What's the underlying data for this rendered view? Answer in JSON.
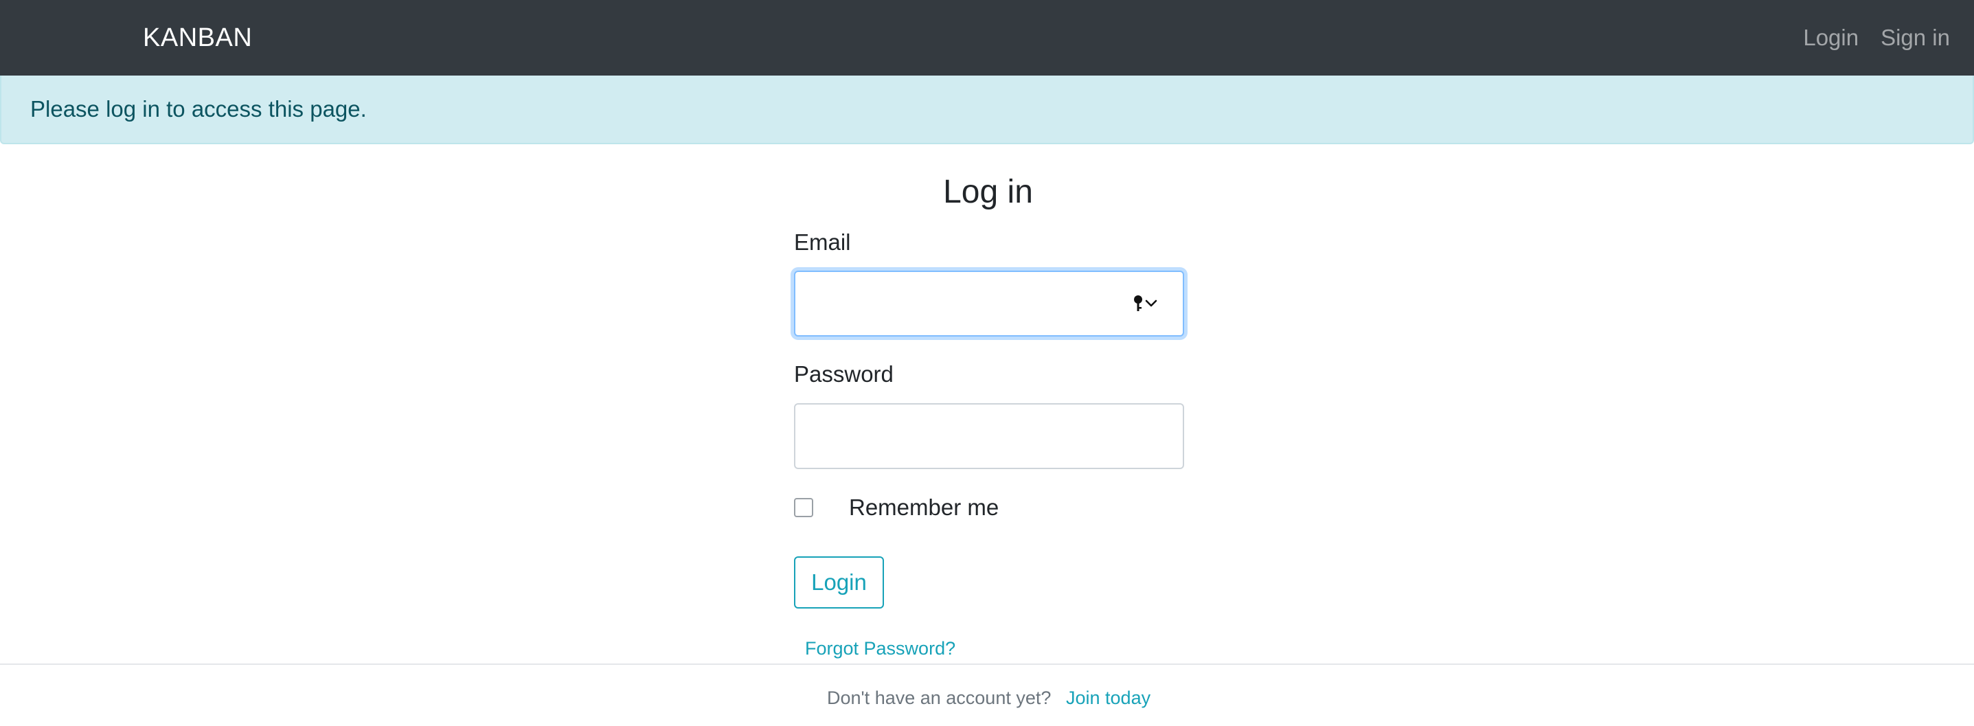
{
  "navbar": {
    "brand": "KANBAN",
    "links": [
      {
        "label": "Login"
      },
      {
        "label": "Sign in"
      }
    ]
  },
  "alert": {
    "message": "Please log in to access this page."
  },
  "form": {
    "title": "Log in",
    "email_label": "Email",
    "email_value": "",
    "email_widget_icon": "key-icon",
    "password_label": "Password",
    "password_value": "",
    "remember_label": "Remember me",
    "remember_checked": false,
    "submit_label": "Login",
    "forgot_label": "Forgot Password?"
  },
  "footer": {
    "prompt": "Don't have an account yet?",
    "join_label": "Join today"
  },
  "colors": {
    "navbar_bg": "#343a40",
    "alert_bg": "#d1ecf1",
    "alert_text": "#0c5460",
    "accent": "#17a2b8",
    "focus_border": "#80bdff"
  }
}
